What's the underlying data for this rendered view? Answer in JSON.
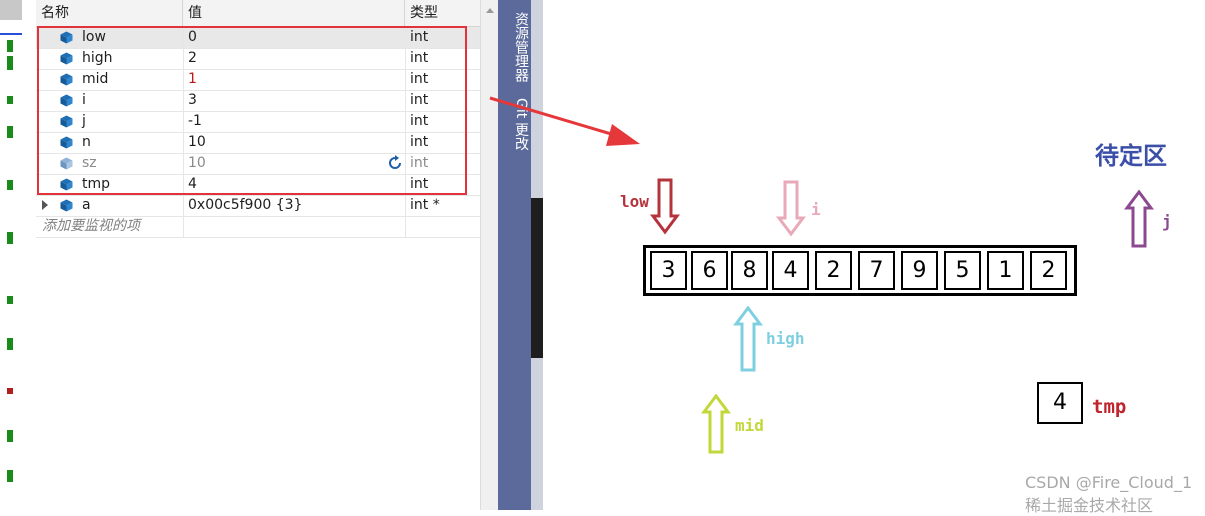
{
  "watch": {
    "columns": [
      "名称",
      "值",
      "类型"
    ],
    "rows": [
      {
        "name": "low",
        "value": "0",
        "type": "int"
      },
      {
        "name": "high",
        "value": "2",
        "type": "int"
      },
      {
        "name": "mid",
        "value": "1",
        "type": "int"
      },
      {
        "name": "i",
        "value": "3",
        "type": "int"
      },
      {
        "name": "j",
        "value": "-1",
        "type": "int"
      },
      {
        "name": "n",
        "value": "10",
        "type": "int"
      },
      {
        "name": "sz",
        "value": "10",
        "type": "int"
      },
      {
        "name": "tmp",
        "value": "4",
        "type": "int"
      },
      {
        "name": "a",
        "value": "0x00c5f900 {3}",
        "type": "int *"
      }
    ],
    "add_hint": "添加要监视的项"
  },
  "sidetabs": {
    "explorer": "资源管理器",
    "git": "Git 更改"
  },
  "diagram": {
    "array": [
      "3",
      "6",
      "8",
      "4",
      "2",
      "7",
      "9",
      "5",
      "1",
      "2"
    ],
    "tmp_value": "4",
    "labels": {
      "low": "low",
      "i": "i",
      "j": "j",
      "high": "high",
      "mid": "mid",
      "tmp": "tmp"
    },
    "zone_title": "待定区",
    "watermark": "CSDN @Fire_Cloud_1 稀土掘金技术社区"
  },
  "colors": {
    "low": "#b5333b",
    "i": "#e9a9b8",
    "j": "#8b4a8f",
    "high": "#7ecfe0",
    "mid": "#c2d83a",
    "tmp": "#c0242c",
    "zone": "#3b4ea8",
    "pointer_arrow": "#e5383b",
    "highlight": "#e0333a"
  }
}
